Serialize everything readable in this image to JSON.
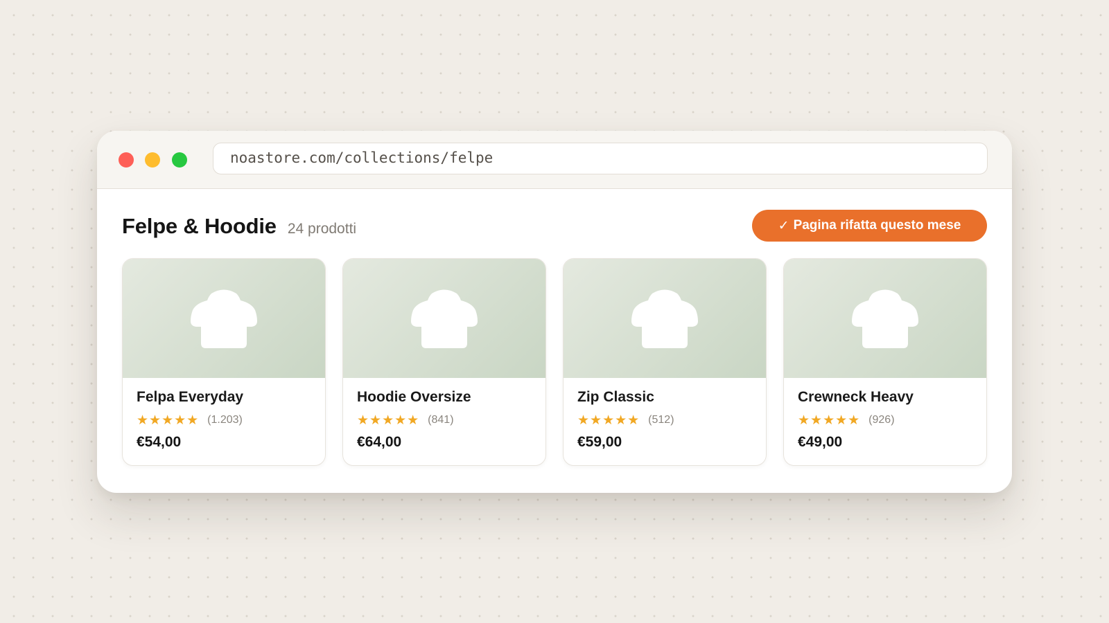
{
  "browser": {
    "url": "noastore.com/collections/felpe"
  },
  "page": {
    "title": "Felpe & Hoodie",
    "count": "24 prodotti",
    "badge": {
      "check": "✓",
      "label": "Pagina rifatta questo mese",
      "color": "#e9702b"
    }
  },
  "products": [
    {
      "name": "Felpa Everyday",
      "stars": "★★★★★",
      "rating": 5,
      "reviews": "(1.203)",
      "price": "€54,00",
      "image_icon": "sweatshirt-icon"
    },
    {
      "name": "Hoodie Oversize",
      "stars": "★★★★★",
      "rating": 5,
      "reviews": "(841)",
      "price": "€64,00",
      "image_icon": "sweatshirt-icon"
    },
    {
      "name": "Zip Classic",
      "stars": "★★★★★",
      "rating": 5,
      "reviews": "(512)",
      "price": "€59,00",
      "image_icon": "sweatshirt-icon"
    },
    {
      "name": "Crewneck Heavy",
      "stars": "★★★★★",
      "rating": 5,
      "reviews": "(926)",
      "price": "€49,00",
      "image_icon": "sweatshirt-icon"
    }
  ],
  "colors": {
    "background": "#f1ede7",
    "accent": "#e9702b",
    "star": "#f1a824",
    "traffic_red": "#fe5f57",
    "traffic_yellow": "#febc2e",
    "traffic_green": "#27c840"
  }
}
